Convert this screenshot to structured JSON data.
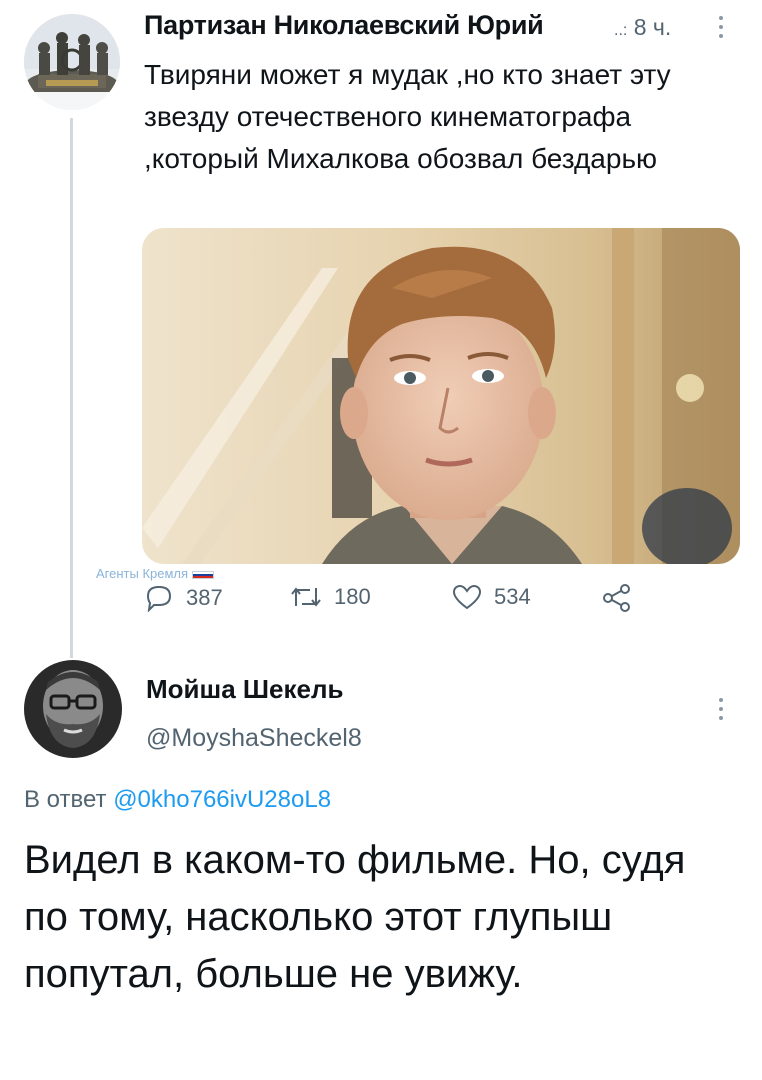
{
  "tweet1": {
    "author_name": "Партизан Николаевский Юрий",
    "meta_separator": "..:",
    "time": "8 ч.",
    "avatar_icon": "monument-statue-avatar",
    "text": "Твиряни может я мудак ,но кто знает эту звезду отечественого кинематографа ,который Михалкова обозвал бездарью",
    "media_icon": "young-man-portrait-photo",
    "watermark": "Агенты Кремля",
    "stats": {
      "replies": "387",
      "retweets": "180",
      "likes": "534"
    }
  },
  "tweet2": {
    "author_name": "Мойша Шекель",
    "handle": "@MoyshaSheckel8",
    "avatar_icon": "bearded-man-glasses-avatar",
    "reply_prefix": "В ответ",
    "reply_handle": "@0kho766ivU28oL8",
    "text": "Видел в каком-то фильме. Но, судя по тому, насколько этот глупыш попутал, больше не увижу."
  },
  "colors": {
    "text": "#0f1419",
    "secondary": "#536471",
    "link": "#1d9bf0",
    "thread_line": "#cfd9de"
  }
}
